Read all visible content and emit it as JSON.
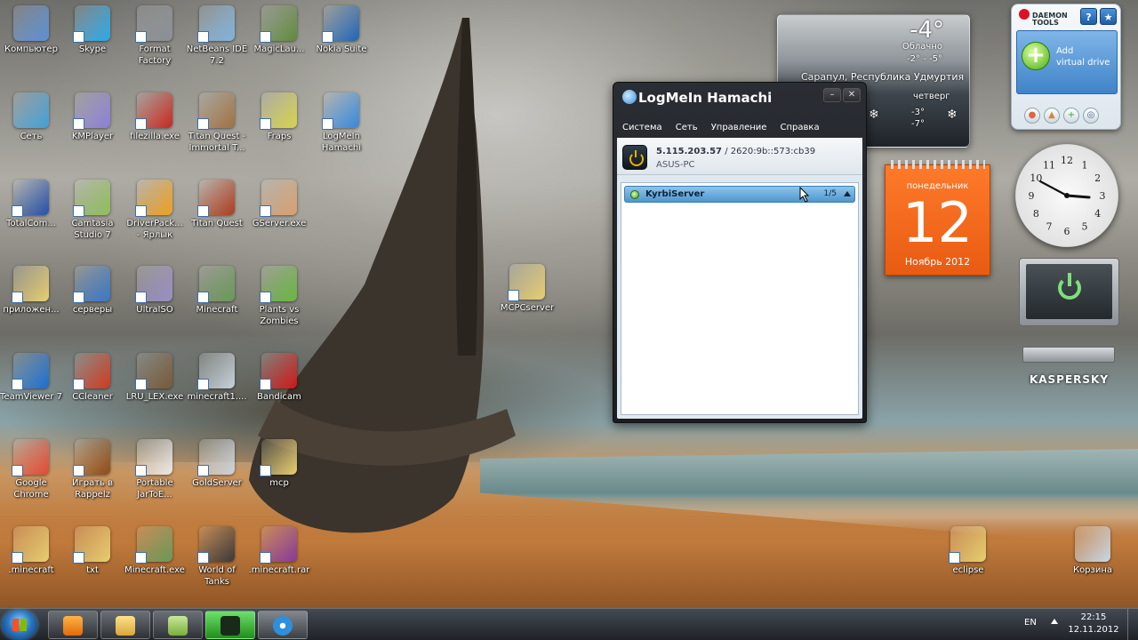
{
  "desktop": {
    "icons": [
      {
        "label": "Компьютер",
        "color": "#5b8fd6"
      },
      {
        "label": "Skype",
        "color": "#29a9e8"
      },
      {
        "label": "Format Factory",
        "color": "#8a8f96"
      },
      {
        "label": "NetBeans IDE 7.2",
        "color": "#7fb2de"
      },
      {
        "label": "MagicLau...",
        "color": "#5f8a3c"
      },
      {
        "label": "Nokia Suite",
        "color": "#1e63b5"
      },
      {
        "label": "Сеть",
        "color": "#3fa0d8"
      },
      {
        "label": "KMPlayer",
        "color": "#8a7fd8"
      },
      {
        "label": "filezilla.exe",
        "color": "#c8261d"
      },
      {
        "label": "Titan Quest - Immortal T...",
        "color": "#a07040"
      },
      {
        "label": "Fraps",
        "color": "#d6d24a"
      },
      {
        "label": "LogMeIn Hamachi",
        "color": "#3388dd"
      },
      {
        "label": "TotalCom...",
        "color": "#2650a8"
      },
      {
        "label": "Camtasia Studio 7",
        "color": "#8fbf5a"
      },
      {
        "label": "DriverPack... - Ярлык",
        "color": "#f0a020"
      },
      {
        "label": "Titan Quest",
        "color": "#b03c1e"
      },
      {
        "label": "GServer.exe",
        "color": "#d9a070"
      },
      {
        "label": "приложен...",
        "color": "#e8cf70"
      },
      {
        "label": "серверы",
        "color": "#3a78c8"
      },
      {
        "label": "UltraISO",
        "color": "#9a8fc8"
      },
      {
        "label": "Minecraft",
        "color": "#6a9a5a"
      },
      {
        "label": "Plants vs Zombies",
        "color": "#6ab840"
      },
      {
        "label": "TeamViewer 7",
        "color": "#1a6ed0"
      },
      {
        "label": "CCleaner",
        "color": "#d23a1e"
      },
      {
        "label": "LRU_LEX.exe",
        "color": "#7a5a3a"
      },
      {
        "label": "minecraft1....",
        "color": "#c8d2dc"
      },
      {
        "label": "Bandicam",
        "color": "#d21a1a"
      },
      {
        "label": "Google Chrome",
        "color": "#dd4a3a"
      },
      {
        "label": "Играть в Rappelz",
        "color": "#8a4a1a"
      },
      {
        "label": "Portable JarToE...",
        "color": "#e8e8e8"
      },
      {
        "label": "GoldServer",
        "color": "#c8d2dc"
      },
      {
        "label": "mcp",
        "color": "#e8cf70"
      },
      {
        "label": ".minecraft",
        "color": "#e8cf70"
      },
      {
        "label": "txt",
        "color": "#e8cf70"
      },
      {
        "label": "Minecraft.exe",
        "color": "#6a9a5a"
      },
      {
        "label": "World of Tanks",
        "color": "#3a3a3a"
      },
      {
        "label": ".minecraft.rar",
        "color": "#8a3a9a"
      },
      {
        "label": "MCPCserver",
        "color": "#e8cf70"
      },
      {
        "label": "eclipse",
        "color": "#e8cf70"
      },
      {
        "label": "Корзина",
        "color": "#c8d8e8"
      }
    ]
  },
  "hamachi": {
    "title": "LogMeIn Hamachi",
    "menu": [
      "Система",
      "Сеть",
      "Управление",
      "Справка"
    ],
    "ipv4": "5.115.203.57",
    "ipv6": " / 2620:9b::573:cb39",
    "client_name": "ASUS-PC",
    "network": {
      "name": "KyrbiServer",
      "count": "1/5"
    },
    "minimize": "–",
    "close": "✕"
  },
  "weather": {
    "temp": "-4°",
    "condition": "Облачно",
    "range": "-2° - -5°",
    "location": "Сарапул, Республика Удмуртия",
    "day": "четверг",
    "hi": "-3°",
    "lo": "-7°"
  },
  "daemon": {
    "brand_top": "DAEMON",
    "brand_bottom": "TOOLS",
    "add_label_1": "Add",
    "add_label_2": "virtual drive"
  },
  "calendar": {
    "day_of_week": "понедельник",
    "day": "12",
    "month_year": "Ноябрь 2012"
  },
  "kaspersky": {
    "brand": "KASPERSKY"
  },
  "taskbar": {
    "language": "EN",
    "time": "22:15",
    "date": "12.11.2012"
  }
}
